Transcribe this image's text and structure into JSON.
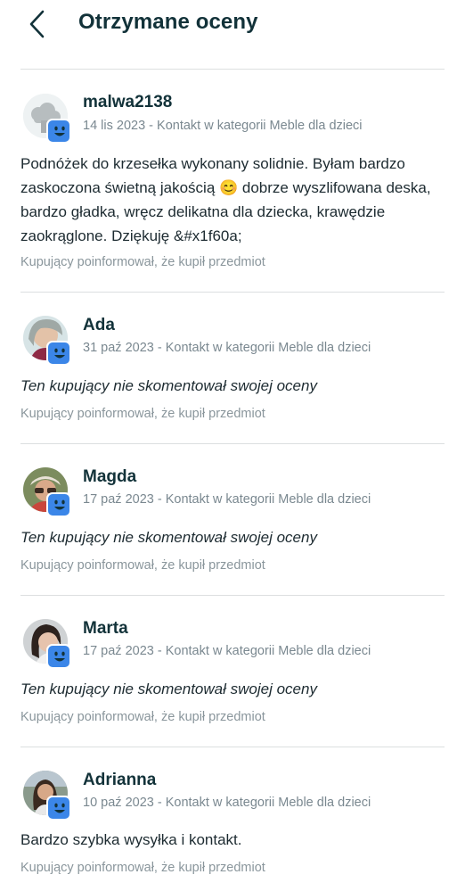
{
  "header": {
    "title": "Otrzymane oceny"
  },
  "icons": {
    "back": "chevron-left-icon",
    "badge": "smile-badge-icon"
  },
  "colors": {
    "accent": "#3b86e8",
    "title": "#123239",
    "muted": "#7a8890"
  },
  "reviews": [
    {
      "username": "malwa2138",
      "meta": "14 lis 2023 - Kontakt w kategorii Meble dla dzieci",
      "comment": "Podnóżek do krzesełka wykonany solidnie. Byłam bardzo zaskoczona świetną jakością 😊 dobrze wyszlifowana deska, bardzo gładka, wręcz delikatna dla dziecka, krawędzie zaokrąglone. Dziękuję &#x1f60a;",
      "note": "Kupujący poinformował, że kupił przedmiot"
    },
    {
      "username": "Ada",
      "meta": "31 paź 2023 - Kontakt w kategorii Meble dla dzieci",
      "comment": "Ten kupujący nie skomentował swojej oceny",
      "note": "Kupujący poinformował, że kupił przedmiot"
    },
    {
      "username": "Magda",
      "meta": "17 paź 2023 - Kontakt w kategorii Meble dla dzieci",
      "comment": "Ten kupujący nie skomentował swojej oceny",
      "note": "Kupujący poinformował, że kupił przedmiot"
    },
    {
      "username": "Marta",
      "meta": "17 paź 2023 - Kontakt w kategorii Meble dla dzieci",
      "comment": "Ten kupujący nie skomentował swojej oceny",
      "note": "Kupujący poinformował, że kupił przedmiot"
    },
    {
      "username": "Adrianna",
      "meta": "10 paź 2023 - Kontakt w kategorii Meble dla dzieci",
      "comment": "Bardzo szybka wysyłka i kontakt.",
      "note": "Kupujący poinformował, że kupił przedmiot"
    }
  ]
}
